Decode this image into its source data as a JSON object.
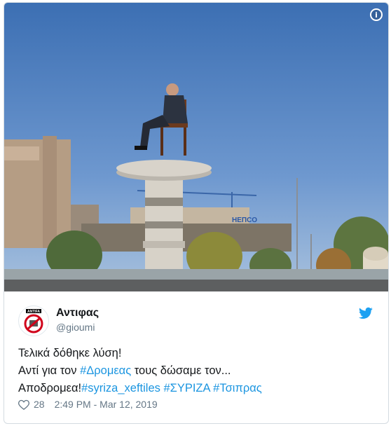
{
  "author": {
    "name": "Αντιφας",
    "handle": "@gioumi",
    "avatar_label": "ANTIFA"
  },
  "tweet": {
    "line1": "Τελικά δόθηκε λύση!",
    "line2_prefix": "Αντί για τον ",
    "line2_tag": "#Δρομεας",
    "line2_suffix": " τους δώσαμε τον...",
    "line3_prefix": "Αποδρομεα!",
    "line3_tags": "#syriza_xeftiles #ΣΥΡΙΖΑ #Τσιπρας"
  },
  "meta": {
    "likes": "28",
    "timestamp": "2:49 PM - Mar 12, 2019"
  },
  "photo": {
    "sign_text": "НЕПCO"
  },
  "icons": {
    "info": "info-icon",
    "bird": "twitter-bird-icon",
    "heart": "heart-icon"
  },
  "colors": {
    "link": "#1b95e0",
    "twitter_blue": "#1da1f2",
    "muted": "#657786"
  }
}
